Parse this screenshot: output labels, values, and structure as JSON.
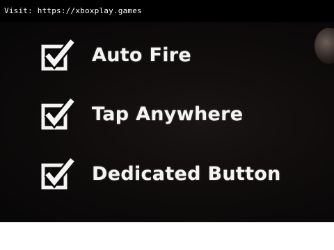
{
  "source_caption": "Visit: https://xboxplay.games",
  "settings": {
    "options": [
      {
        "label": "Auto Fire",
        "checked": true
      },
      {
        "label": "Tap Anywhere",
        "checked": true
      },
      {
        "label": "Dedicated Button",
        "checked": true
      }
    ]
  },
  "colors": {
    "background": "#0e0b0b",
    "text": "#f4f4f4",
    "checkbox": "#f4f4f4"
  },
  "icons": {
    "checkbox": "checkmark-box-icon"
  }
}
